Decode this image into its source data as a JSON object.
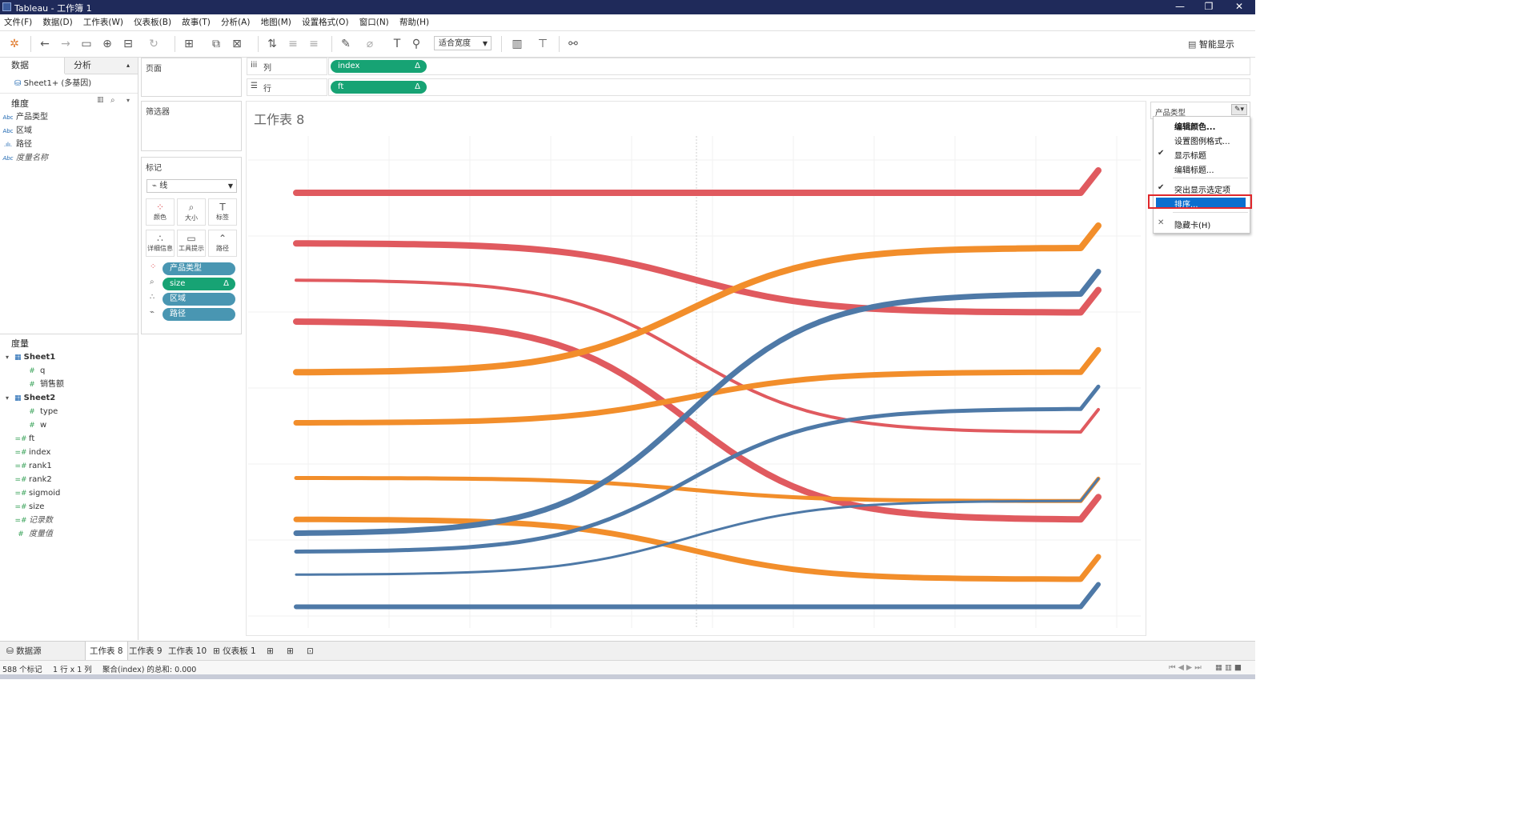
{
  "window": {
    "title": "Tableau - 工作簿 1",
    "min": "—",
    "restore": "❐",
    "close": "✕"
  },
  "menu": [
    "文件(F)",
    "数据(D)",
    "工作表(W)",
    "仪表板(B)",
    "故事(T)",
    "分析(A)",
    "地图(M)",
    "设置格式(O)",
    "窗口(N)",
    "帮助(H)"
  ],
  "toolbar": {
    "fit": "适合宽度",
    "smart_show": "智能显示"
  },
  "data_pane": {
    "tab_data": "数据",
    "tab_analysis": "分析",
    "datasource": "Sheet1+ (多基因)",
    "dimensions_label": "维度",
    "dimensions": [
      {
        "icon": "Abc",
        "name": "产品类型"
      },
      {
        "icon": "Abc",
        "name": "区域"
      },
      {
        "icon": ".ılı.",
        "name": "路径"
      },
      {
        "icon": "Abc",
        "name": "度量名称"
      }
    ],
    "measures_label": "度量",
    "measures": [
      {
        "group": "Sheet1",
        "fields": [
          "q",
          "销售额"
        ]
      },
      {
        "group": "Sheet2",
        "fields": [
          "type",
          "w"
        ]
      }
    ],
    "calc_fields": [
      "ft",
      "index",
      "rank1",
      "rank2",
      "sigmoid",
      "size",
      "记录数",
      "度量值"
    ]
  },
  "cards": {
    "pages": "页面",
    "filters": "筛选器",
    "marks": "标记",
    "mark_type": "线",
    "mark_buttons": [
      "颜色",
      "大小",
      "标签",
      "详细信息",
      "工具提示",
      "路径"
    ],
    "mark_pills": [
      {
        "name": "产品类型",
        "kind": "color"
      },
      {
        "name": "size",
        "kind": "size"
      },
      {
        "name": "区域",
        "kind": "detail"
      },
      {
        "name": "路径",
        "kind": "path"
      }
    ]
  },
  "shelves": {
    "columns_label": "列",
    "rows_label": "行",
    "columns_pill": "index",
    "rows_pill": "ft",
    "delta": "Δ"
  },
  "viz": {
    "title": "工作表 8",
    "colors": {
      "red": "#e05a5f",
      "orange": "#f28e2b",
      "blue": "#4e79a7"
    },
    "series": [
      {
        "color": "red",
        "start": 0.08,
        "end": 0.08,
        "w": 8
      },
      {
        "color": "red",
        "start": 0.19,
        "end": 0.34,
        "w": 8
      },
      {
        "color": "red",
        "start": 0.27,
        "end": 0.6,
        "w": 4
      },
      {
        "color": "red",
        "start": 0.36,
        "end": 0.79,
        "w": 8
      },
      {
        "color": "orange",
        "start": 0.47,
        "end": 0.2,
        "w": 8
      },
      {
        "color": "orange",
        "start": 0.58,
        "end": 0.47,
        "w": 7
      },
      {
        "color": "orange",
        "start": 0.7,
        "end": 0.75,
        "w": 5
      },
      {
        "color": "orange",
        "start": 0.79,
        "end": 0.92,
        "w": 7
      },
      {
        "color": "blue",
        "start": 0.82,
        "end": 0.3,
        "w": 7
      },
      {
        "color": "blue",
        "start": 0.86,
        "end": 0.55,
        "w": 5
      },
      {
        "color": "blue",
        "start": 0.91,
        "end": 0.75,
        "w": 3
      },
      {
        "color": "blue",
        "start": 0.98,
        "end": 0.98,
        "w": 6
      }
    ]
  },
  "legend": {
    "title": "产品类型",
    "menu": [
      {
        "label": "编辑颜色...",
        "bold": true,
        "check": ""
      },
      {
        "label": "设置图例格式...",
        "bold": false,
        "check": ""
      },
      {
        "label": "显示标题",
        "bold": false,
        "check": "✔"
      },
      {
        "label": "编辑标题...",
        "bold": false,
        "check": ""
      },
      {
        "label": "突出显示选定项",
        "bold": false,
        "check": "✔"
      },
      {
        "label": "排序...",
        "bold": false,
        "check": ""
      },
      {
        "label": "隐藏卡(H)",
        "bold": false,
        "check": "✕"
      }
    ]
  },
  "sheet_tabs": [
    "数据源",
    "工作表 8",
    "工作表 9",
    "工作表 10",
    "仪表板 1"
  ],
  "status": {
    "marks": "588 个标记",
    "rowscols": "1 行 x 1 列",
    "sum": "聚合(index) 的总和: 0.000"
  }
}
